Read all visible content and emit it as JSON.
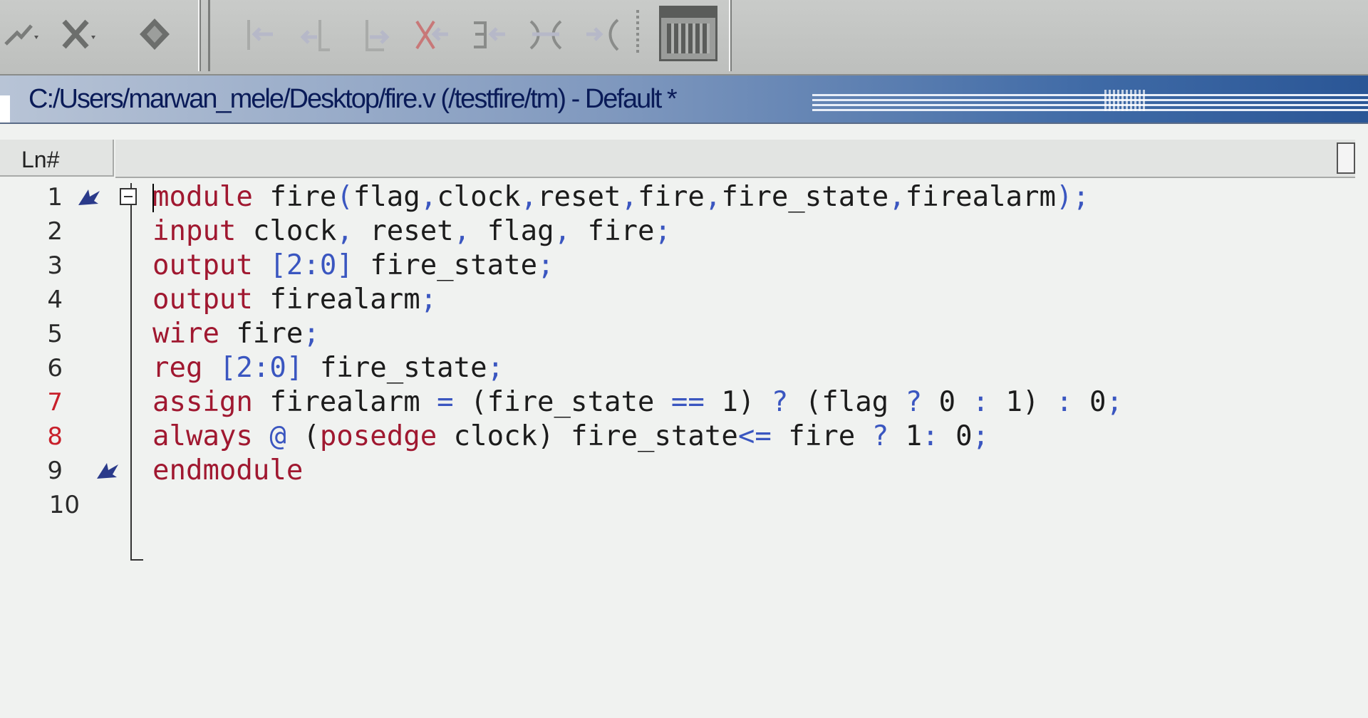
{
  "toolbar": {
    "left_icons": [
      "wave-dropdown-icon",
      "delete-dropdown-icon",
      "zoom-icon"
    ],
    "cursor_icons": [
      "goto-first-icon",
      "goto-prev-icon",
      "goto-next-icon",
      "goto-last-icon",
      "find-prev-edge-icon",
      "find-next-edge-icon",
      "expand-icon"
    ],
    "panel_icon": "calculator-icon"
  },
  "window": {
    "title": "C:/Users/marwan_mele/Desktop/fire.v (/testfire/tm) - Default *"
  },
  "editor": {
    "ln_header": "Ln#",
    "lines": [
      {
        "num": "1",
        "red": false,
        "bookmark": true,
        "fold": true,
        "tokens": [
          {
            "t": "module",
            "k": "kw"
          },
          {
            "t": " fire",
            "k": ""
          },
          {
            "t": "(",
            "k": "op"
          },
          {
            "t": "flag",
            "k": ""
          },
          {
            "t": ",",
            "k": "op"
          },
          {
            "t": "clock",
            "k": ""
          },
          {
            "t": ",",
            "k": "op"
          },
          {
            "t": "reset",
            "k": ""
          },
          {
            "t": ",",
            "k": "op"
          },
          {
            "t": "fire",
            "k": ""
          },
          {
            "t": ",",
            "k": "op"
          },
          {
            "t": "fire_state",
            "k": ""
          },
          {
            "t": ",",
            "k": "op"
          },
          {
            "t": "firealarm",
            "k": ""
          },
          {
            "t": ");",
            "k": "op"
          }
        ]
      },
      {
        "num": "2",
        "red": false,
        "bookmark": false,
        "fold": false,
        "tokens": [
          {
            "t": "input",
            "k": "kw"
          },
          {
            "t": " clock",
            "k": ""
          },
          {
            "t": ",",
            "k": "op"
          },
          {
            "t": " reset",
            "k": ""
          },
          {
            "t": ",",
            "k": "op"
          },
          {
            "t": " flag",
            "k": ""
          },
          {
            "t": ",",
            "k": "op"
          },
          {
            "t": " fire",
            "k": ""
          },
          {
            "t": ";",
            "k": "op"
          }
        ]
      },
      {
        "num": "3",
        "red": false,
        "bookmark": false,
        "fold": false,
        "tokens": [
          {
            "t": "output",
            "k": "kw"
          },
          {
            "t": " ",
            "k": ""
          },
          {
            "t": "[2:0]",
            "k": "op"
          },
          {
            "t": " fire_state",
            "k": ""
          },
          {
            "t": ";",
            "k": "op"
          }
        ]
      },
      {
        "num": "4",
        "red": false,
        "bookmark": false,
        "fold": false,
        "tokens": [
          {
            "t": "output",
            "k": "kw"
          },
          {
            "t": " firealarm",
            "k": ""
          },
          {
            "t": ";",
            "k": "op"
          }
        ]
      },
      {
        "num": "5",
        "red": false,
        "bookmark": false,
        "fold": false,
        "tokens": [
          {
            "t": "wire",
            "k": "kw"
          },
          {
            "t": " fire",
            "k": ""
          },
          {
            "t": ";",
            "k": "op"
          }
        ]
      },
      {
        "num": "6",
        "red": false,
        "bookmark": false,
        "fold": false,
        "tokens": [
          {
            "t": "reg",
            "k": "kw"
          },
          {
            "t": " ",
            "k": ""
          },
          {
            "t": "[2:0]",
            "k": "op"
          },
          {
            "t": " fire_state",
            "k": ""
          },
          {
            "t": ";",
            "k": "op"
          }
        ]
      },
      {
        "num": "7",
        "red": true,
        "bookmark": false,
        "fold": false,
        "tokens": [
          {
            "t": "assign",
            "k": "kw"
          },
          {
            "t": " firealarm ",
            "k": ""
          },
          {
            "t": "=",
            "k": "op"
          },
          {
            "t": " (fire_state ",
            "k": ""
          },
          {
            "t": "==",
            "k": "op"
          },
          {
            "t": " 1) ",
            "k": ""
          },
          {
            "t": "?",
            "k": "op"
          },
          {
            "t": " (flag ",
            "k": ""
          },
          {
            "t": "?",
            "k": "op"
          },
          {
            "t": " 0 ",
            "k": ""
          },
          {
            "t": ":",
            "k": "op"
          },
          {
            "t": " 1) ",
            "k": ""
          },
          {
            "t": ":",
            "k": "op"
          },
          {
            "t": " 0",
            "k": ""
          },
          {
            "t": ";",
            "k": "op"
          }
        ]
      },
      {
        "num": "8",
        "red": true,
        "bookmark": false,
        "fold": false,
        "tokens": [
          {
            "t": "always",
            "k": "kw"
          },
          {
            "t": " ",
            "k": ""
          },
          {
            "t": "@",
            "k": "op"
          },
          {
            "t": " (",
            "k": ""
          },
          {
            "t": "posedge",
            "k": "kw"
          },
          {
            "t": " clock) fire_state",
            "k": ""
          },
          {
            "t": "<=",
            "k": "op"
          },
          {
            "t": " fire ",
            "k": ""
          },
          {
            "t": "?",
            "k": "op"
          },
          {
            "t": " 1",
            "k": ""
          },
          {
            "t": ":",
            "k": "op"
          },
          {
            "t": " 0",
            "k": ""
          },
          {
            "t": ";",
            "k": "op"
          }
        ]
      },
      {
        "num": "9",
        "red": false,
        "bookmark": true,
        "fold": false,
        "tokens": [
          {
            "t": "endmodule",
            "k": "kw"
          }
        ]
      },
      {
        "num": "10",
        "red": false,
        "bookmark": false,
        "fold": false,
        "tokens": []
      }
    ]
  },
  "colors": {
    "keyword": "#a01830",
    "operator": "#3a56c0",
    "text": "#1c1c1c",
    "title_text": "#0a1b58"
  }
}
